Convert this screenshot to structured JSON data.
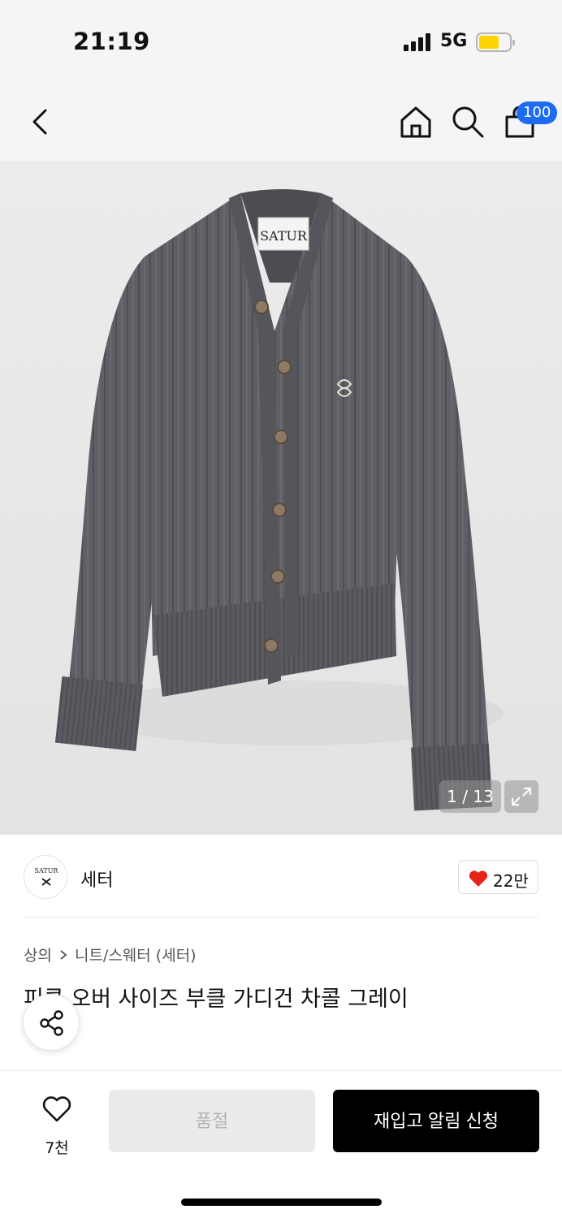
{
  "status": {
    "time": "21:19",
    "network": "5G"
  },
  "nav": {
    "cart_badge": "100"
  },
  "gallery": {
    "counter": "1 / 13",
    "garment_label": "SATUR"
  },
  "brand": {
    "logo_text": "SATUR",
    "name": "세터",
    "likes": "22만"
  },
  "product": {
    "breadcrumb": [
      "상의",
      "니트/스웨터 (세터)"
    ],
    "title": "피클 오버 사이즈 부클 가디건 차콜 그레이"
  },
  "footer": {
    "wish_count": "7천",
    "soldout_label": "품절",
    "restock_label": "재입고 알림 신청"
  },
  "colors": {
    "accent_blue": "#1d6bf0",
    "like_red": "#e8231c",
    "battery_yellow": "#ffd400",
    "cardigan_gray": "#5f5f66"
  },
  "icons": [
    "back-icon",
    "home-icon",
    "search-icon",
    "shopping-bag-icon",
    "expand-icon",
    "heart-icon",
    "share-icon",
    "signal-icon",
    "battery-icon"
  ]
}
